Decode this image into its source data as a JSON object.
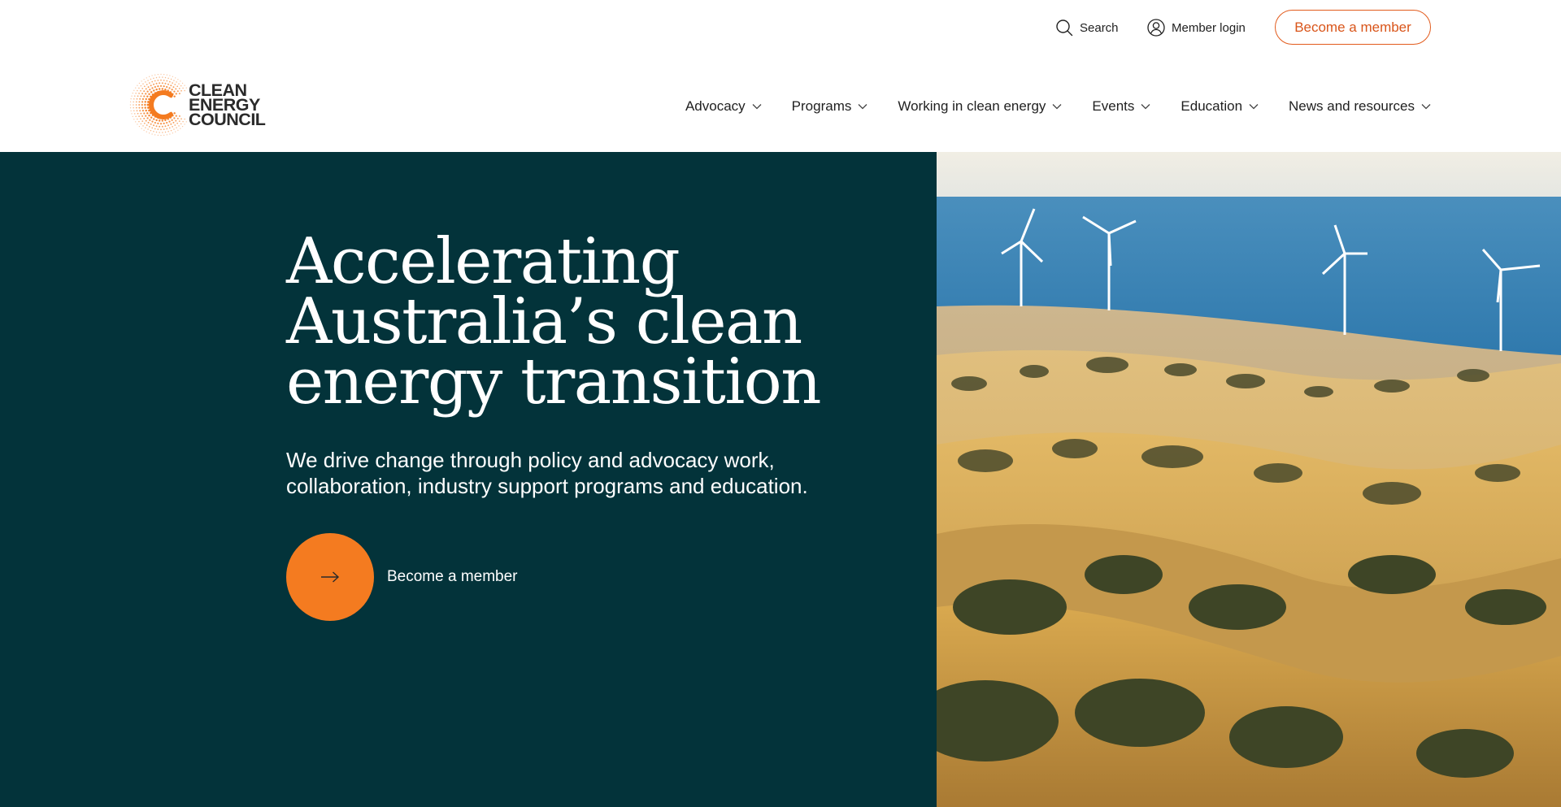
{
  "utility": {
    "search_label": "Search",
    "search_icon": "search-icon",
    "login_label": "Member login",
    "login_icon": "user-icon",
    "cta_label": "Become a member"
  },
  "logo": {
    "line1": "CLEAN",
    "line2": "ENERGY",
    "line3": "COUNCIL",
    "mark_color": "#f47b20"
  },
  "nav": {
    "items": [
      {
        "label": "Advocacy"
      },
      {
        "label": "Programs"
      },
      {
        "label": "Working in clean energy"
      },
      {
        "label": "Events"
      },
      {
        "label": "Education"
      },
      {
        "label": "News and resources"
      }
    ]
  },
  "hero": {
    "title_line1": "Accelerating",
    "title_line2": "Australia’s clean",
    "title_line3": "energy transition",
    "subtitle": "We drive change through policy and advocacy work, collaboration, industry support programs and education.",
    "cta_label": "Become a member",
    "cta_icon": "arrow-right-icon",
    "image_subject": "wind-farm-landscape"
  },
  "colors": {
    "accent": "#f47b20",
    "accent_border": "#e25b1c",
    "hero_bg": "#03333a",
    "text_dark": "#1f1f1f"
  }
}
